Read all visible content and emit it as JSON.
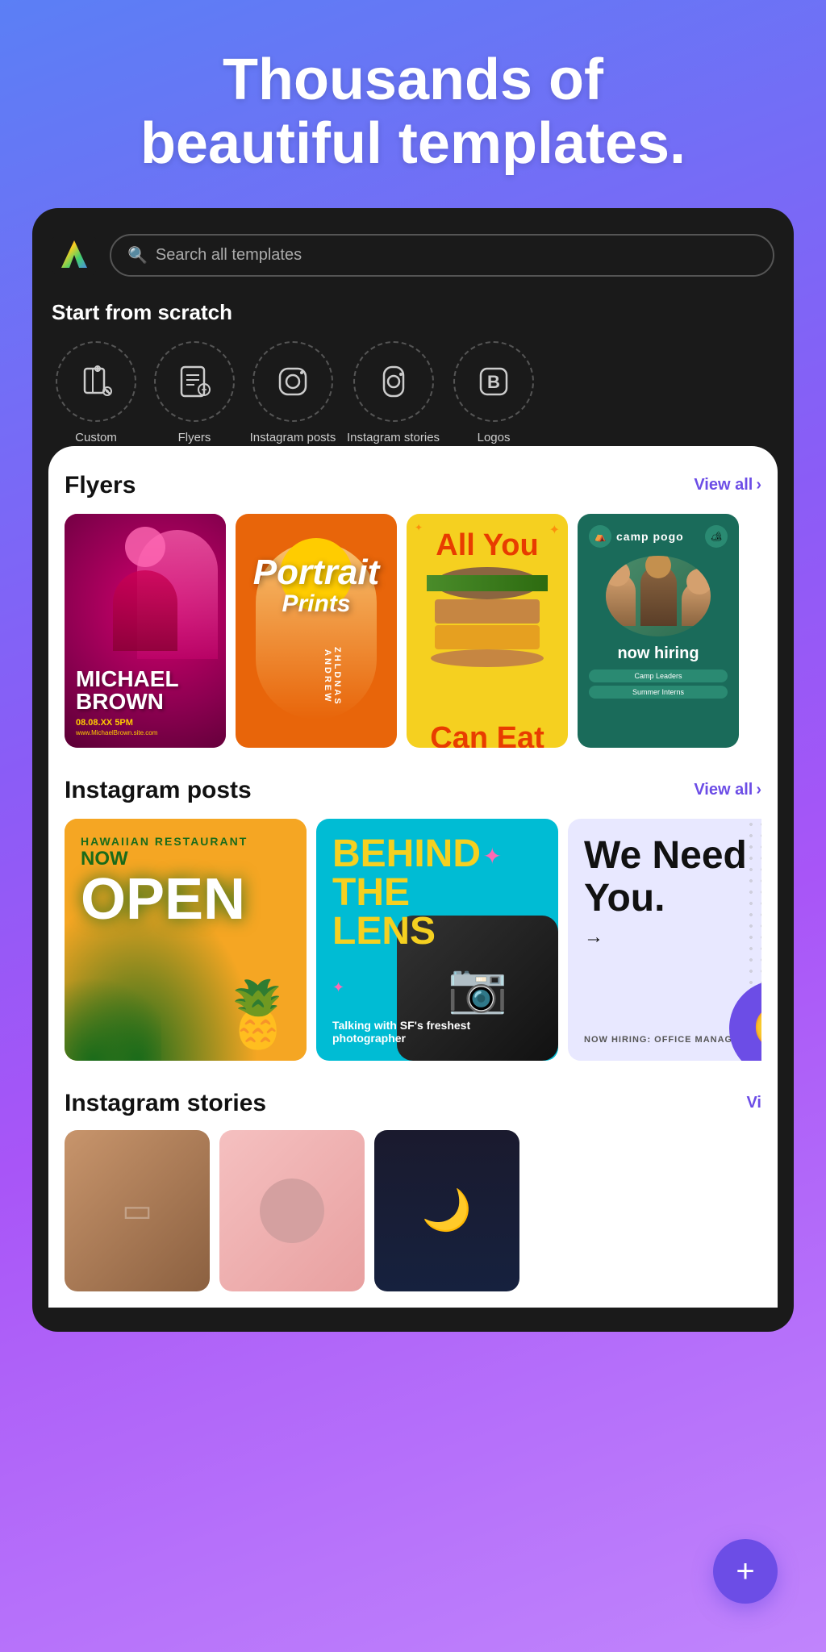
{
  "hero": {
    "title_line1": "Thousands of",
    "title_line2": "beautiful templates."
  },
  "search": {
    "placeholder": "Search all templates"
  },
  "start_from_scratch": {
    "heading": "Start from scratch",
    "items": [
      {
        "id": "custom",
        "label": "Custom",
        "icon": "📄"
      },
      {
        "id": "flyers",
        "label": "Flyers",
        "icon": "🖼"
      },
      {
        "id": "instagram-posts",
        "label": "Instagram posts",
        "icon": "📷"
      },
      {
        "id": "instagram-stories",
        "label": "Instagram stories",
        "icon": "📱"
      },
      {
        "id": "logos",
        "label": "Logos",
        "icon": "🅱"
      }
    ]
  },
  "sections": {
    "flyers": {
      "heading": "Flyers",
      "view_all": "View all"
    },
    "instagram_posts": {
      "heading": "Instagram posts",
      "view_all": "View all"
    },
    "instagram_stories": {
      "heading": "Instagram stories",
      "view_all": "Vi"
    }
  },
  "flyers": [
    {
      "id": "michael-brown",
      "name": "MICHAEL BROWN",
      "date": "08.08.XX 5PM",
      "url": "www.MichaelBrown.site.com"
    },
    {
      "id": "portrait-prints",
      "line1": "Portrait",
      "line2": "Prints"
    },
    {
      "id": "all-you-can-eat",
      "line1": "All You",
      "line2": "Can Eat"
    },
    {
      "id": "camp-pogo",
      "camp_name": "camp pogo",
      "tagline": "now hiring",
      "tags": [
        "Camp Leaders",
        "Summer Interns"
      ]
    }
  ],
  "instagram_posts": [
    {
      "id": "hawaiian",
      "restaurant": "HAWAIIAN RESTAURANT",
      "now": "NOW",
      "open": "OPEN"
    },
    {
      "id": "behind-lens",
      "title": "BEHIND THE LENS",
      "subtitle": "Talking with SF's freshest photographer"
    },
    {
      "id": "we-need-you",
      "line1": "We Need",
      "line2": "You.",
      "hiring": "NOW HIRING: OFFICE MANAGER"
    }
  ],
  "fab": {
    "label": "+"
  }
}
